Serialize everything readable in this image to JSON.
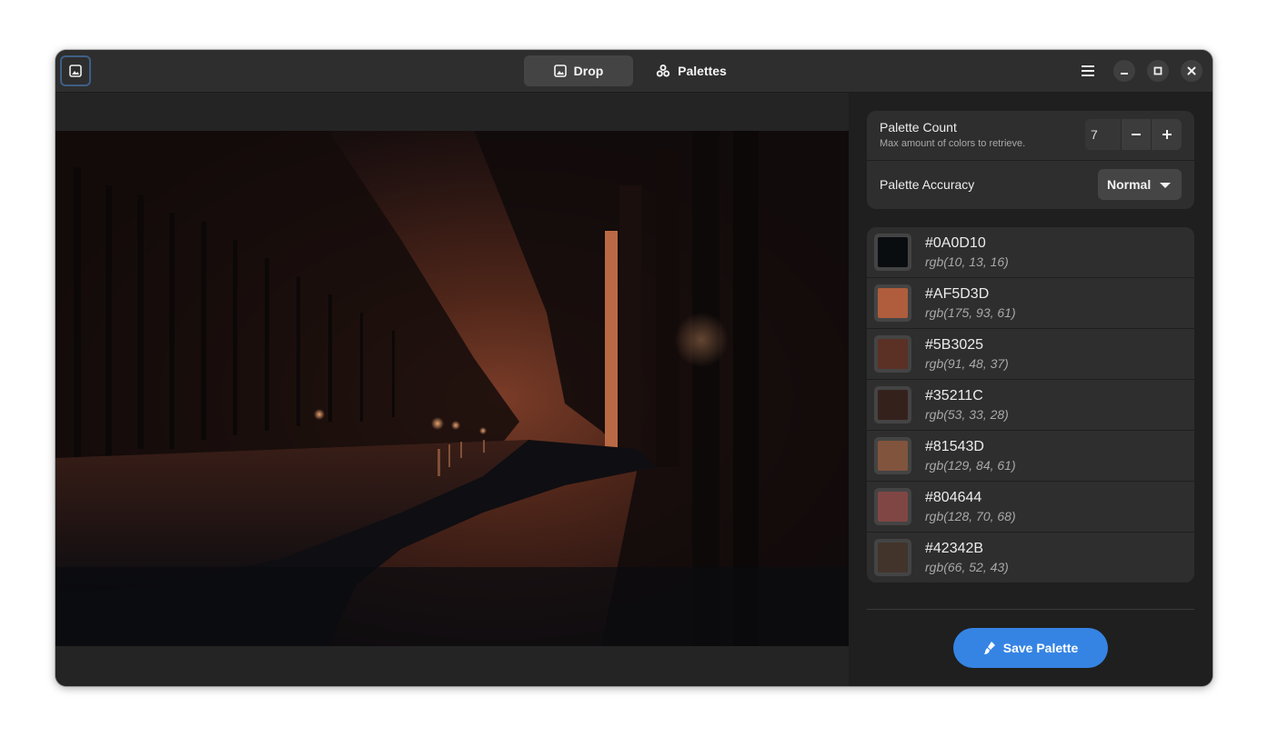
{
  "header": {
    "tabs": [
      {
        "label": "Drop",
        "icon": "image-icon",
        "active": true
      },
      {
        "label": "Palettes",
        "icon": "palettes-icon",
        "active": false
      }
    ],
    "icons": {
      "toggle": "image-icon",
      "menu": "hamburger-menu-icon",
      "minimize": "minimize-icon",
      "maximize": "maximize-icon",
      "close": "close-icon"
    }
  },
  "settings": {
    "count_label": "Palette Count",
    "count_sub": "Max amount of colors to retrieve.",
    "count_value": "7",
    "accuracy_label": "Palette Accuracy",
    "accuracy_value": "Normal"
  },
  "palette": [
    {
      "hex": "#0A0D10",
      "rgb": "rgb(10, 13, 16)",
      "color": "#0A0D10"
    },
    {
      "hex": "#AF5D3D",
      "rgb": "rgb(175, 93, 61)",
      "color": "#AF5D3D"
    },
    {
      "hex": "#5B3025",
      "rgb": "rgb(91, 48, 37)",
      "color": "#5B3025"
    },
    {
      "hex": "#35211C",
      "rgb": "rgb(53, 33, 28)",
      "color": "#35211C"
    },
    {
      "hex": "#81543D",
      "rgb": "rgb(129, 84, 61)",
      "color": "#81543D"
    },
    {
      "hex": "#804644",
      "rgb": "rgb(128, 70, 68)",
      "color": "#804644"
    },
    {
      "hex": "#42342B",
      "rgb": "rgb(66, 52, 43)",
      "color": "#42342B"
    }
  ],
  "save_label": "Save Palette",
  "colors": {
    "accent": "#3584e4",
    "window_bg": "#242424",
    "sidebar_bg": "#1f1f1f",
    "card_bg": "#2e2e2e"
  }
}
